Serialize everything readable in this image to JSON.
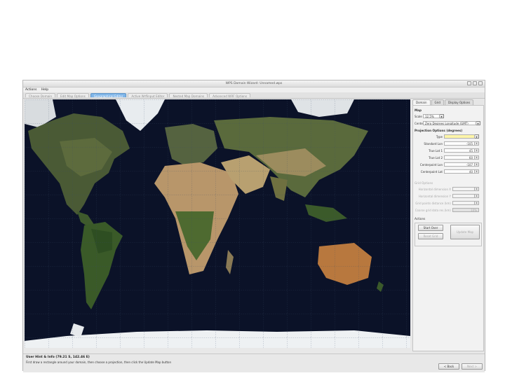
{
  "window": {
    "title": "WPS Domain Wizard: Unnamed.wps"
  },
  "menu": [
    "Actions",
    "Help"
  ],
  "tabs": [
    {
      "label": "Choose Domain",
      "active": false
    },
    {
      "label": "Edit Map Options",
      "active": false
    },
    {
      "label": "Geographical Editor",
      "active": true
    },
    {
      "label": "Active Wrflinput Editor",
      "active": false
    },
    {
      "label": "Nested Map Domains",
      "active": false
    },
    {
      "label": "Advanced WRF Options",
      "active": false
    }
  ],
  "side_tabs": [
    {
      "label": "Domain",
      "active": true
    },
    {
      "label": "Grid",
      "active": false
    },
    {
      "label": "Display Options",
      "active": false
    }
  ],
  "map_section": {
    "title": "Map",
    "scale_label": "Scale",
    "scale_value": "12.5%",
    "center_label": "Center",
    "center_value": "Zero Degrees Longitude (GMT)"
  },
  "projection": {
    "title": "Projection Options (degrees)",
    "type_label": "Type",
    "type_value": "",
    "standard_lon_label": "Standard Lon",
    "standard_lon_value": "-105",
    "true_lat1_label": "True Lat 1",
    "true_lat1_value": "45",
    "true_lat2_label": "True Lat 2",
    "true_lat2_value": "60",
    "center_lon_label": "Centerpoint Lon",
    "center_lon_value": "-107",
    "center_lat_label": "Centerpoint Lat",
    "center_lat_value": "40"
  },
  "grid": {
    "title": "Grid Options",
    "hdim_x_label": "Horizontal dimension X",
    "hdim_y_label": "Horizontal dimension Y",
    "grid_dist_label": "Grid points distance (km)",
    "coarse_label": "Coarse grid data res.(km)",
    "coarse_value": "10%"
  },
  "actions": {
    "title": "Actions",
    "start_over": "Start Over",
    "reset_grid": "Reset Grid",
    "update_map": "Update Map"
  },
  "status": {
    "title": "User Hint & Info   (79.21 S, 142.46 E)",
    "hint": "First draw a rectangle around your domain, then choose a projection, then click the Update Map button"
  },
  "nav": {
    "back": "< Back",
    "next": "Next >"
  },
  "colors": {
    "active_tab": "#7fb5e8",
    "ocean": "#0b1228",
    "highlight_field": "#fdf5a8"
  }
}
